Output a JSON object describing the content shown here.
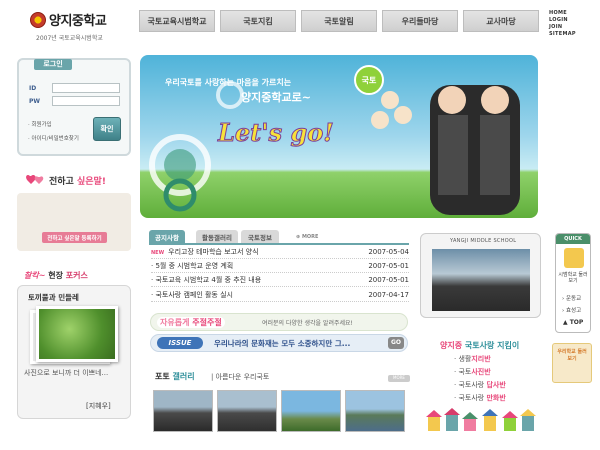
{
  "header": {
    "logo_text": "양지중학교",
    "logo_sub": "2007년 국토교육시범학교",
    "nav": [
      "국토교육시범학교",
      "국토지킴",
      "국토알림",
      "우리들마당",
      "교사마당"
    ],
    "util": [
      "HOME",
      "LOGIN",
      "JOIN",
      "SITEMAP"
    ]
  },
  "login": {
    "tab": "로그인",
    "id_label": "ID",
    "pw_label": "PW",
    "button": "확인",
    "links": [
      "회원가입",
      "아이디/비밀번호찾기"
    ]
  },
  "heart": {
    "title_a": "전하고 ",
    "title_b": "싶은말!",
    "button": "전하고 싶은말 등록하기"
  },
  "scene": {
    "title_a": "찰칵~",
    "title_b": " 현장 ",
    "title_c": "포커스",
    "subtitle": "토끼풀과 민들레",
    "desc": "사진으로 보니까 더 이쁘네...",
    "author": "[지혜우]"
  },
  "visual": {
    "line1": "우리국토를 사랑하는 마음을 가르치는",
    "line2": "양지중학교로~",
    "lets": "Let's go!",
    "ball": "국토"
  },
  "board": {
    "tabs": [
      "공지사항",
      "활동갤러리",
      "국토정보"
    ],
    "more": "MORE",
    "new_label": "NEW",
    "rows": [
      {
        "title": "우리고장 테마학습 보고서 양식",
        "date": "2007-05-04",
        "new": true
      },
      {
        "title": "5월 중 시범학교 운영 계획",
        "date": "2007-05-01",
        "new": false
      },
      {
        "title": "국토교육 시범학교 4월 중 추진 내용",
        "date": "2007-05-01",
        "new": false
      },
      {
        "title": "국토사랑 캠페인 활동 실시",
        "date": "2007-04-17",
        "new": false
      }
    ]
  },
  "free": {
    "title_a": "자유롭게 ",
    "title_b": "주절주절",
    "desc": "여러분의 다양한 생각을 알려주세요!"
  },
  "issue": {
    "badge": "ISSUE",
    "text": "우리나라의 문화재는 모두 소중하지만 그...",
    "go": "GO"
  },
  "gallery": {
    "title_a": "포토 ",
    "title_b": "갤러리",
    "subtitle": "| 아름다운 우리국토",
    "more": "MORE"
  },
  "school": {
    "label": "YANGJI MIDDLE SCHOOL"
  },
  "map": {
    "title_a": "양지중 ",
    "title_b": "국토사랑 지킴이",
    "items": [
      {
        "prefix": "생활",
        "bold": "지리반"
      },
      {
        "prefix": "국토",
        "bold": "사진반"
      },
      {
        "prefix": "국토사랑 ",
        "bold": "답사반"
      },
      {
        "prefix": "국토사랑 ",
        "bold": "만화반"
      }
    ]
  },
  "quick": {
    "head": "QUICK",
    "caption": "시범학교 둘러보기",
    "links": [
      "운동교",
      "효성고"
    ],
    "top": "TOP",
    "banner": "우리학교 둘러보기"
  },
  "colors": {
    "accent": "#6aa5aa",
    "pink": "#e8477a",
    "teal": "#2e8f9a"
  }
}
